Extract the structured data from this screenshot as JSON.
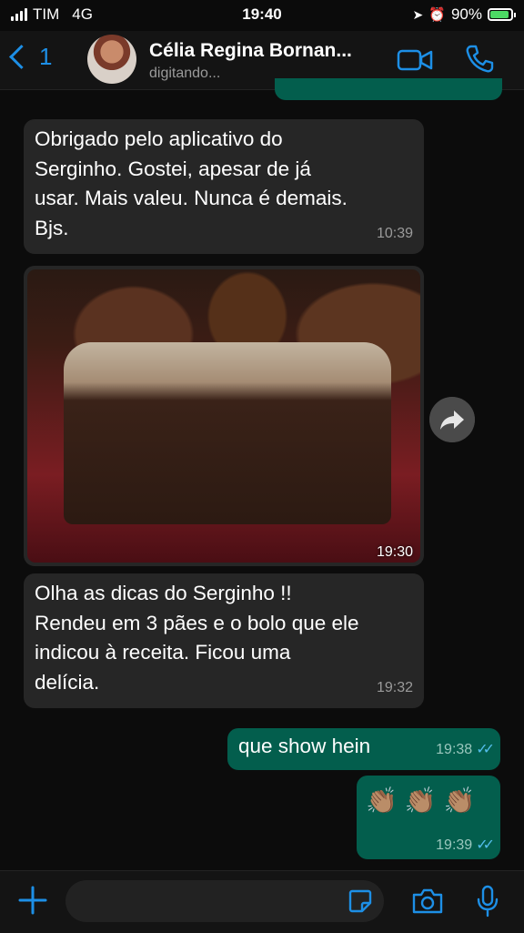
{
  "status_bar": {
    "carrier": "TIM",
    "network": "4G",
    "time": "19:40",
    "battery": "90%",
    "battery_level": 0.9
  },
  "header": {
    "back_count": "1",
    "contact_name": "Célia Regina Bornan...",
    "contact_status": "digitando..."
  },
  "messages": [
    {
      "direction": "in",
      "text_lines": [
        "Obrigado pelo aplicativo  do",
        "Serginho.  Gostei,  apesar de já",
        "usar. Mais valeu. Nunca é  demais.",
        "Bjs."
      ],
      "time": "10:39"
    },
    {
      "direction": "in",
      "type": "image",
      "time": "19:30"
    },
    {
      "direction": "in",
      "text_lines": [
        "Olha as dicas  do Serginho  !!",
        "Rendeu em 3 pães  e o bolo que ele",
        "indicou à  receita. Ficou uma",
        "delícia."
      ],
      "time": "19:32"
    },
    {
      "direction": "out",
      "text": "que show hein",
      "time": "19:38"
    },
    {
      "direction": "out",
      "text": "👏🏽👏🏽👏🏽",
      "time": "19:39"
    }
  ],
  "colors": {
    "accent": "#1d8fe6",
    "outgoing_bubble": "#035e4d",
    "incoming_bubble": "#262626",
    "read_ticks": "#53bdeb"
  },
  "icons": [
    "back-chevron-icon",
    "video-call-icon",
    "phone-icon",
    "forward-icon",
    "plus-icon",
    "sticker-icon",
    "camera-icon",
    "microphone-icon"
  ]
}
